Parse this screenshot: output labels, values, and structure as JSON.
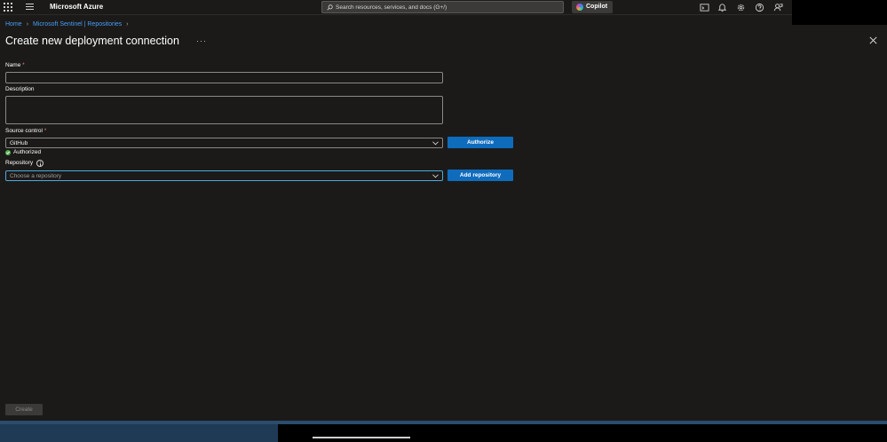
{
  "app": {
    "brand": "Microsoft Azure",
    "search_placeholder": "Search resources, services, and docs (G+/)",
    "copilot_label": "Copilot"
  },
  "breadcrumb": {
    "items": [
      "Home",
      "Microsoft Sentinel | Repositories"
    ]
  },
  "page": {
    "title": "Create new deployment connection",
    "more_label": "···"
  },
  "form": {
    "name": {
      "label": "Name",
      "required_mark": "*",
      "value": ""
    },
    "description": {
      "label": "Description",
      "value": ""
    },
    "source_control": {
      "label": "Source control",
      "required_mark": "*",
      "selected": "GitHub",
      "authorize_label": "Authorize",
      "status": "Authorized"
    },
    "repository": {
      "label": "Repository",
      "placeholder": "Choose a repository",
      "add_label": "Add repository"
    },
    "create_label": "Create"
  },
  "icons": {
    "apps": "waffle-icon",
    "menu": "hamburger-icon",
    "search": "search-icon",
    "cloud_shell": "terminal-icon",
    "notifications": "bell-icon",
    "settings": "gear-icon",
    "help": "question-icon",
    "feedback": "feedback-icon",
    "close": "close-icon",
    "info": "info-icon",
    "chevron": "chevron-down-icon",
    "status_ok": "check-circle-icon"
  },
  "colors": {
    "background": "#1b1a19",
    "accent": "#0f6cbd",
    "link": "#479ef5",
    "success": "#54b054",
    "required": "#e0867b"
  }
}
